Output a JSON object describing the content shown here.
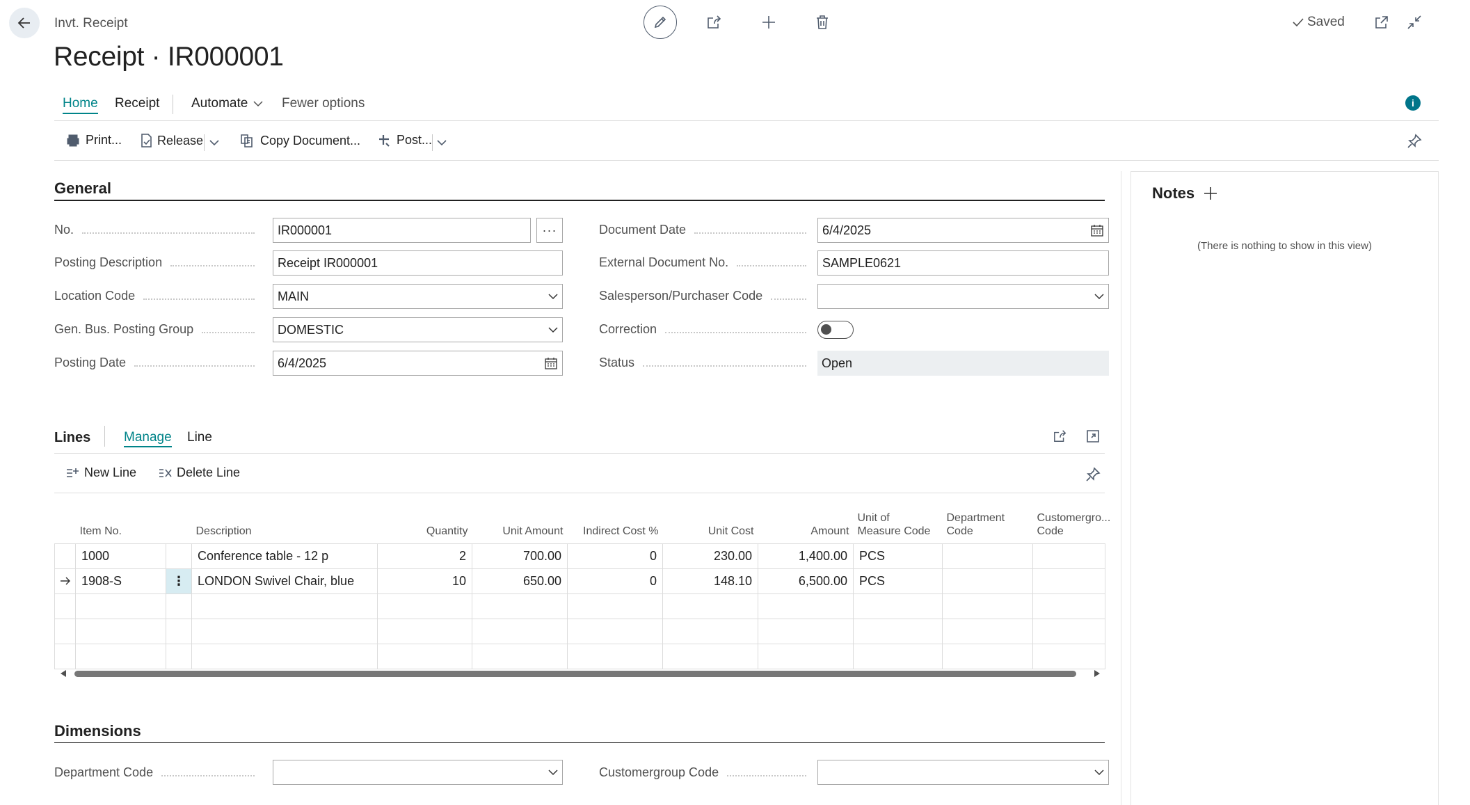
{
  "header": {
    "breadcrumb": "Invt. Receipt",
    "title": "Receipt · IR000001",
    "saved_status": "Saved"
  },
  "tabs": {
    "home": "Home",
    "receipt": "Receipt",
    "automate": "Automate",
    "fewer_options": "Fewer options"
  },
  "actions": {
    "print": "Print...",
    "release": "Release",
    "copy_document": "Copy Document...",
    "post": "Post..."
  },
  "general": {
    "title": "General",
    "fields": {
      "no": {
        "label": "No.",
        "value": "IR000001"
      },
      "posting_description": {
        "label": "Posting Description",
        "value": "Receipt IR000001"
      },
      "location_code": {
        "label": "Location Code",
        "value": "MAIN"
      },
      "gen_bus_posting_group": {
        "label": "Gen. Bus. Posting Group",
        "value": "DOMESTIC"
      },
      "posting_date": {
        "label": "Posting Date",
        "value": "6/4/2025"
      },
      "document_date": {
        "label": "Document Date",
        "value": "6/4/2025"
      },
      "external_document_no": {
        "label": "External Document No.",
        "value": "SAMPLE0621"
      },
      "salesperson_purchaser_code": {
        "label": "Salesperson/Purchaser Code",
        "value": ""
      },
      "correction": {
        "label": "Correction",
        "value": false
      },
      "status": {
        "label": "Status",
        "value": "Open"
      }
    }
  },
  "lines": {
    "title": "Lines",
    "tabs": {
      "manage": "Manage",
      "line": "Line"
    },
    "actions": {
      "new_line": "New Line",
      "delete_line": "Delete Line"
    },
    "columns": {
      "item_no": "Item No.",
      "description": "Description",
      "quantity": "Quantity",
      "unit_amount": "Unit Amount",
      "indirect_cost": "Indirect Cost %",
      "unit_cost": "Unit Cost",
      "amount": "Amount",
      "uom_1": "Unit of",
      "uom_2": "Measure Code",
      "dept_1": "Department",
      "dept_2": "Code",
      "cust_1": "Customergro...",
      "cust_2": "Code"
    },
    "rows": [
      {
        "item_no": "1000",
        "description": "Conference table - 12 p",
        "quantity": "2",
        "unit_amount": "700.00",
        "indirect_cost": "0",
        "unit_cost": "230.00",
        "amount": "1,400.00",
        "uom": "PCS",
        "dept": "",
        "cust": ""
      },
      {
        "item_no": "1908-S",
        "description": "LONDON Swivel Chair, blue",
        "quantity": "10",
        "unit_amount": "650.00",
        "indirect_cost": "0",
        "unit_cost": "148.10",
        "amount": "6,500.00",
        "uom": "PCS",
        "dept": "",
        "cust": ""
      }
    ]
  },
  "dimensions": {
    "title": "Dimensions",
    "department_code": {
      "label": "Department Code",
      "value": ""
    },
    "customergroup_code": {
      "label": "Customergroup Code",
      "value": ""
    }
  },
  "notes": {
    "title": "Notes",
    "empty_text": "(There is nothing to show in this view)"
  },
  "colors": {
    "accent": "#008489",
    "info": "#00758a",
    "selected_row_marker": "#d7ecf2"
  }
}
